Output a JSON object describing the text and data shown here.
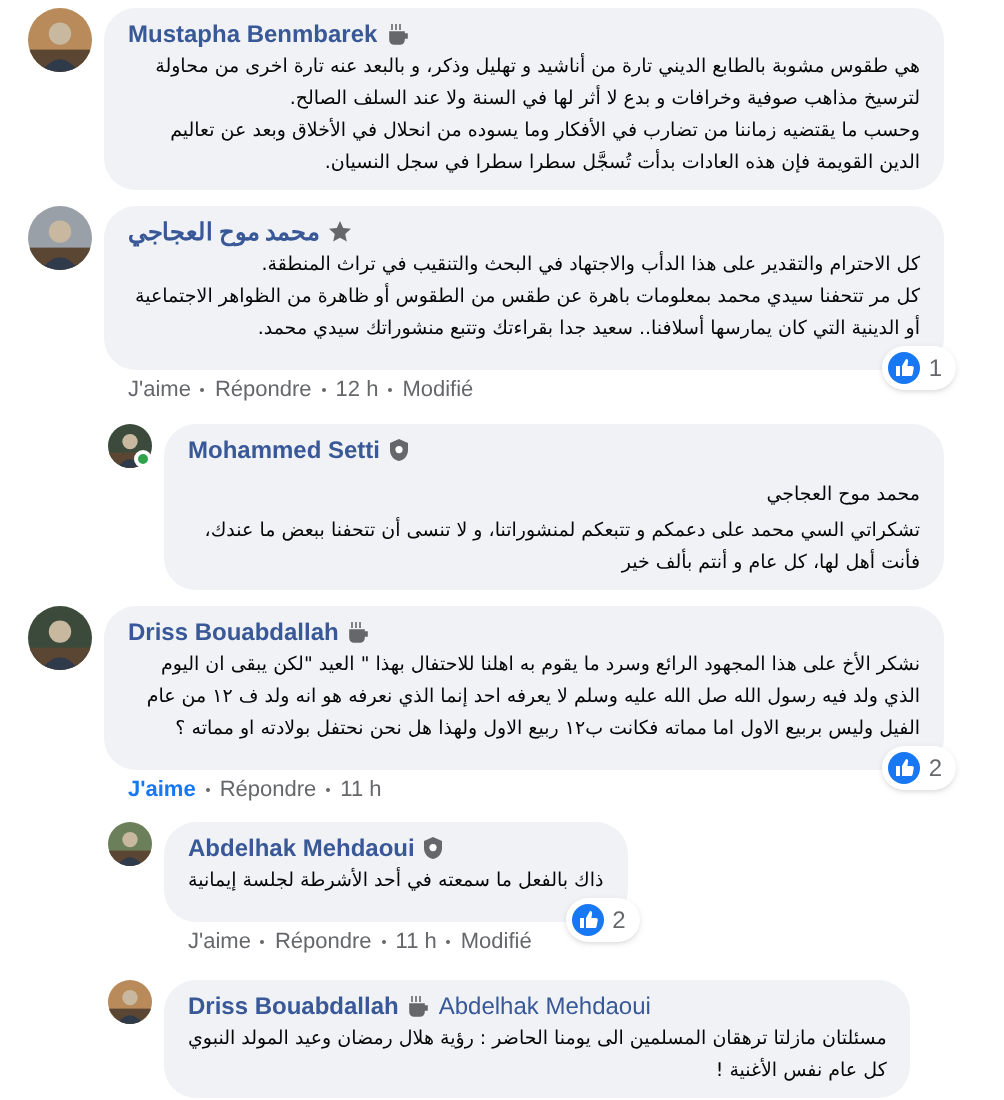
{
  "comments": [
    {
      "author": "Mustapha Benmbarek",
      "badge": {
        "kind": "coffee"
      },
      "paragraphs": [
        "هي طقوس مشوبة بالطابع الديني تارة من أناشيد و تهليل وذكر، و بالبعد عنه تارة اخرى من محاولة لترسيخ مذاهب صوفية وخرافات و بدع لا أثر لها في السنة ولا عند السلف الصالح.",
        "وحسب ما يقتضيه زماننا من تضارب في الأفكار وما يسوده من انحلال في الأخلاق وبعد عن تعاليم الدين القويمة فإن هذه العادات بدأت تُسجَّل سطرا سطرا في سجل النسيان."
      ]
    },
    {
      "author": "محمد موح العجاجي",
      "badge": {
        "kind": "star"
      },
      "paragraphs": [
        "كل الاحترام والتقدير على هذا الدأب والاجتهاد في البحث والتنقيب في تراث المنطقة.",
        "كل مر تتحفنا سيدي محمد بمعلومات باهرة عن طقس من الطقوس أو ظاهرة من الظواهر الاجتماعية أو الدينية التي كان يمارسها أسلافنا.. سعيد جدا بقراءتك وتتبع منشوراتك سيدي محمد."
      ],
      "actions": {
        "like": "J'aime",
        "liked": false,
        "reply": "Répondre",
        "time": "12 h",
        "edited": "Modifié"
      },
      "reactions": "1",
      "replies": [
        {
          "author": "Mohammed Setti",
          "badge": {
            "kind": "shield"
          },
          "online": true,
          "tag": "محمد موح العجاجي",
          "paragraphs": [
            "تشكراتي السي محمد على دعمكم و تتبعكم لمنشوراتنا، و لا تنسى أن تتحفنا ببعض ما عندك، فأنت أهل لها، كل عام و أنتم بألف خير"
          ]
        }
      ]
    },
    {
      "author": "Driss Bouabdallah",
      "badge": {
        "kind": "coffee"
      },
      "paragraphs": [
        "نشكر الأخ على هذا المجهود الرائع وسرد ما يقوم به اهلنا للاحتفال بهذا \" العيد \"لكن يبقى ان اليوم الذي ولد فيه رسول الله صل الله عليه وسلم لا يعرفه احد إنما الذي نعرفه هو انه ولد ف ١٢ من عام الفيل وليس بربيع الاول اما مماته فكانت ب١٢ ربيع الاول ولهذا هل نحن نحتفل بولادته او مماته ؟"
      ],
      "actions": {
        "like": "J'aime",
        "liked": true,
        "reply": "Répondre",
        "time": "11 h"
      },
      "reactions": "2",
      "replies": [
        {
          "author": "Abdelhak Mehdaoui",
          "badge": {
            "kind": "shield"
          },
          "online": false,
          "paragraphs": [
            "ذاك بالفعل ما سمعته في أحد الأشرطة لجلسة إيمانية"
          ],
          "actions": {
            "like": "J'aime",
            "liked": false,
            "reply": "Répondre",
            "time": "11 h",
            "edited": "Modifié"
          },
          "reactions": "2"
        },
        {
          "author": "Driss Bouabdallah",
          "badge": {
            "kind": "coffee"
          },
          "online": false,
          "tag": "Abdelhak Mehdaoui",
          "paragraphs": [
            "مسئلتان مازلتا ترهقان المسلمين الى يومنا الحاضر : رؤية هلال رمضان وعيد المولد النبوي",
            "كل عام نفس الأغنية !"
          ]
        }
      ]
    }
  ]
}
